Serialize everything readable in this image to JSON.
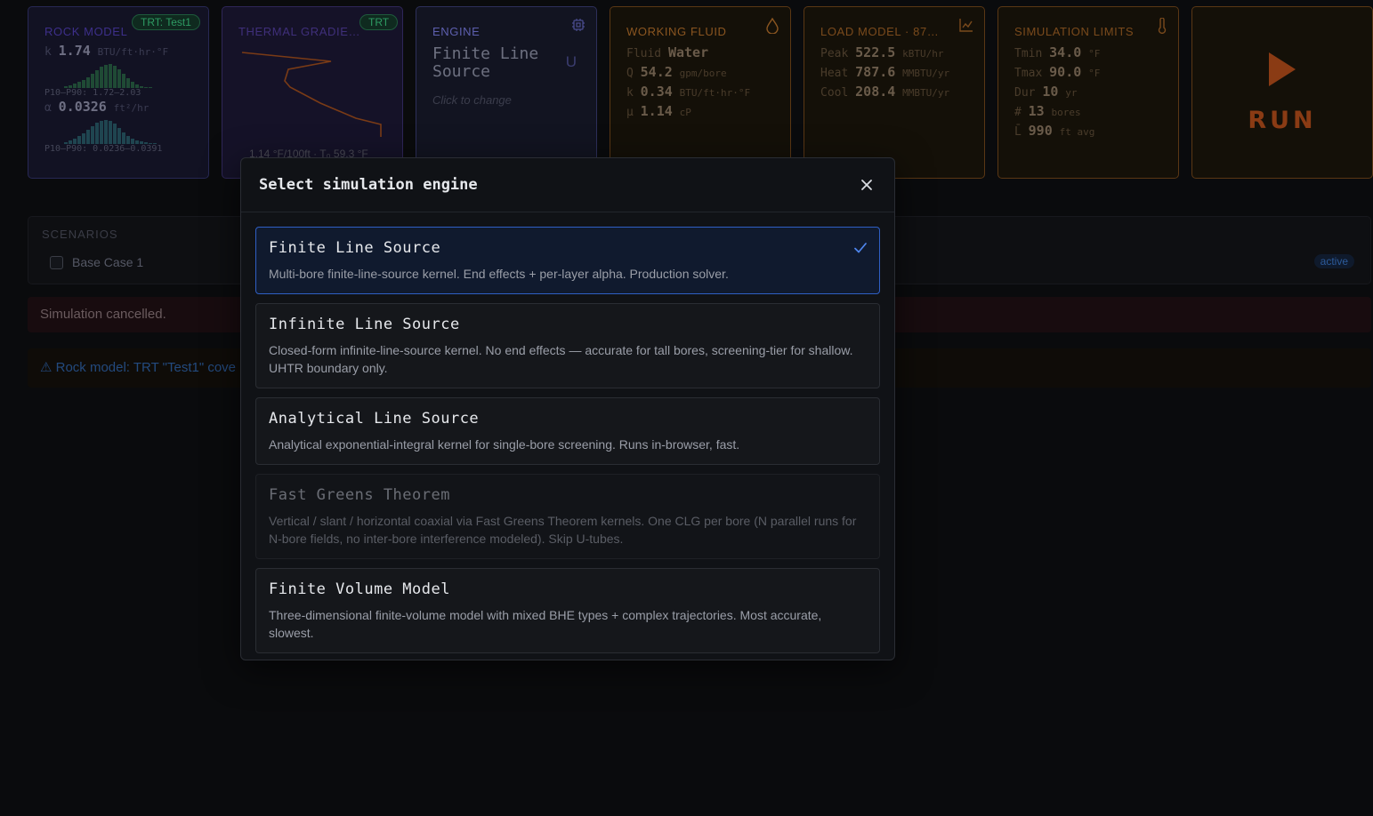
{
  "cards": {
    "rock": {
      "title": "ROCK MODEL",
      "badge": "TRT: Test1",
      "k_label": "k",
      "k_value": "1.74",
      "k_unit": "BTU/ft·hr·°F",
      "k_range": "P10–P90: 1.72–2.03",
      "alpha_label": "α",
      "alpha_value": "0.0326",
      "alpha_unit": "ft²/hr",
      "alpha_range": "P10–P90: 0.0236–0.0391"
    },
    "thermal": {
      "title": "THERMAL GRADIENT",
      "badge": "TRT",
      "caption": "1.14 °F/100ft · T₀ 59.3 °F"
    },
    "engine": {
      "title": "ENGINE",
      "name_line1": "Finite Line",
      "name_line2": "Source",
      "suffix": "U",
      "hint": "Click to change"
    },
    "fluid": {
      "title": "WORKING FLUID",
      "fluid_label": "Fluid",
      "fluid_value": "Water",
      "q_label": "Q",
      "q_value": "54.2",
      "q_unit": "gpm/bore",
      "k_label": "k",
      "k_value": "0.34",
      "k_unit": "BTU/ft·hr·°F",
      "mu_label": "μ",
      "mu_value": "1.14",
      "mu_unit": "cP"
    },
    "load": {
      "title": "LOAD MODEL · 87…",
      "peak_label": "Peak",
      "peak_value": "522.5",
      "peak_unit": "kBTU/hr",
      "heat_label": "Heat",
      "heat_value": "787.6",
      "heat_unit": "MMBTU/yr",
      "cool_label": "Cool",
      "cool_value": "208.4",
      "cool_unit": "MMBTU/yr"
    },
    "sim": {
      "title": "SIMULATION LIMITS",
      "tmin_label": "Tmin",
      "tmin_value": "34.0",
      "tmin_unit": "°F",
      "tmax_label": "Tmax",
      "tmax_value": "90.0",
      "tmax_unit": "°F",
      "dur_label": "Dur",
      "dur_value": "10",
      "dur_unit": "yr",
      "n_label": "#",
      "n_value": "13",
      "n_unit": "bores",
      "l_label": "L̄",
      "l_value": "990",
      "l_unit": "ft avg"
    },
    "run": {
      "label": "RUN"
    }
  },
  "scenarios": {
    "title": "SCENARIOS",
    "items": [
      {
        "name": "Base Case 1",
        "status": "active"
      }
    ]
  },
  "alerts": {
    "error": "Simulation cancelled.",
    "warning": "⚠ Rock model: TRT \"Test1\" cove"
  },
  "modal": {
    "title": "Select simulation engine",
    "options": [
      {
        "name": "Finite Line Source",
        "desc": "Multi-bore finite-line-source kernel. End effects + per-layer alpha. Production solver.",
        "selected": true
      },
      {
        "name": "Infinite Line Source",
        "desc": "Closed-form infinite-line-source kernel. No end effects — accurate for tall bores, screening-tier for shallow. UHTR boundary only."
      },
      {
        "name": "Analytical Line Source",
        "desc": "Analytical exponential-integral kernel for single-bore screening. Runs in-browser, fast."
      },
      {
        "name": "Fast Greens Theorem",
        "desc": "Vertical / slant / horizontal coaxial via Fast Greens Theorem kernels. One CLG per bore (N parallel runs for N-bore fields, no inter-bore interference modeled). Skip U-tubes.",
        "disabled": true
      },
      {
        "name": "Finite Volume Model",
        "desc": "Three-dimensional finite-volume model with mixed BHE types + complex trajectories. Most accurate, slowest."
      }
    ]
  },
  "colors": {
    "accent_blue": "#2f5fc4",
    "run_orange": "#8a3b14",
    "badge_green": "#2e9b63"
  },
  "icons": [
    "cpu-icon",
    "drop-icon",
    "chart-icon",
    "thermometer-icon",
    "play-icon",
    "close-icon",
    "check-icon"
  ]
}
